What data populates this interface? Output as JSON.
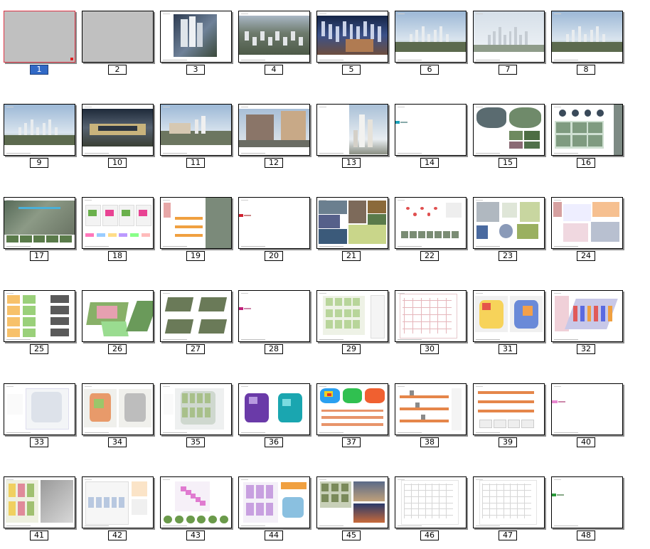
{
  "slides": [
    {
      "number": "1",
      "type": "gray",
      "selected": true
    },
    {
      "number": "2",
      "type": "gray"
    },
    {
      "number": "3",
      "type": "photo-left-buildings"
    },
    {
      "number": "4",
      "type": "photo-aerial"
    },
    {
      "number": "5",
      "type": "photo-night"
    },
    {
      "number": "6",
      "type": "photo-sky"
    },
    {
      "number": "7",
      "type": "photo-sky-towers"
    },
    {
      "number": "8",
      "type": "photo-sky"
    },
    {
      "number": "9",
      "type": "photo-sky"
    },
    {
      "number": "10",
      "type": "photo-dusk"
    },
    {
      "number": "11",
      "type": "photo-street"
    },
    {
      "number": "12",
      "type": "photo-residence"
    },
    {
      "number": "13",
      "type": "photo-tower-right"
    },
    {
      "number": "14",
      "type": "section-cyan"
    },
    {
      "number": "15",
      "type": "map-china"
    },
    {
      "number": "16",
      "type": "circles-grid"
    },
    {
      "number": "17",
      "type": "satellite"
    },
    {
      "number": "18",
      "type": "diagram-maps"
    },
    {
      "number": "19",
      "type": "diagram-orange"
    },
    {
      "number": "20",
      "type": "section-red"
    },
    {
      "number": "21",
      "type": "photo-collage"
    },
    {
      "number": "22",
      "type": "diagram-nodes"
    },
    {
      "number": "23",
      "type": "diagram-analysis"
    },
    {
      "number": "24",
      "type": "diagram-sections"
    },
    {
      "number": "25",
      "type": "diagram-blocks"
    },
    {
      "number": "26",
      "type": "model-3d"
    },
    {
      "number": "27",
      "type": "model-terrain"
    },
    {
      "number": "28",
      "type": "section-magenta"
    },
    {
      "number": "29",
      "type": "plan-green"
    },
    {
      "number": "30",
      "type": "plan-lines"
    },
    {
      "number": "31",
      "type": "plan-colored"
    },
    {
      "number": "32",
      "type": "plan-axon"
    },
    {
      "number": "33",
      "type": "plan-site"
    },
    {
      "number": "34",
      "type": "plan-two"
    },
    {
      "number": "35",
      "type": "plan-site-green"
    },
    {
      "number": "36",
      "type": "plan-purple-teal"
    },
    {
      "number": "37",
      "type": "heatmap"
    },
    {
      "number": "38",
      "type": "elevations"
    },
    {
      "number": "39",
      "type": "elevations-table"
    },
    {
      "number": "40",
      "type": "section-pink"
    },
    {
      "number": "41",
      "type": "plan-model"
    },
    {
      "number": "42",
      "type": "plan-details"
    },
    {
      "number": "43",
      "type": "plan-pink-circles"
    },
    {
      "number": "44",
      "type": "plan-lavender"
    },
    {
      "number": "45",
      "type": "photo-mix"
    },
    {
      "number": "46",
      "type": "plan-linework"
    },
    {
      "number": "47",
      "type": "plan-linework"
    },
    {
      "number": "48",
      "type": "section-green"
    }
  ]
}
